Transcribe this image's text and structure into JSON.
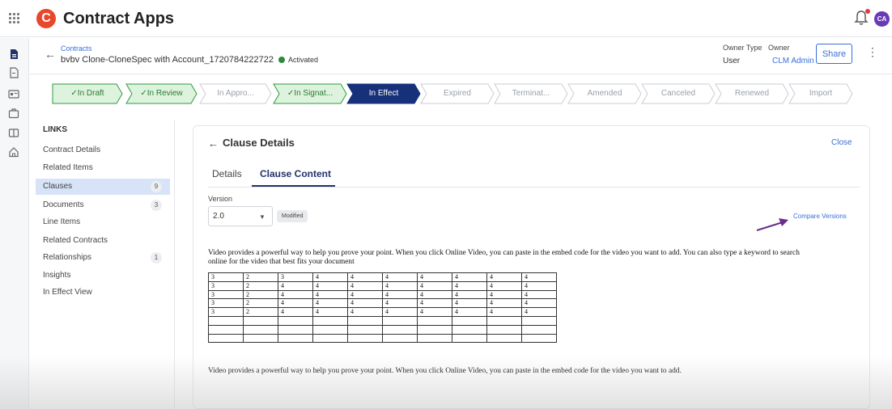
{
  "app": {
    "logo_letter": "C",
    "title": "Contract Apps",
    "avatar_initials": "CA",
    "brand_color": "#e8472b",
    "accent": "#3a6fd8"
  },
  "header": {
    "breadcrumb": "Contracts",
    "contract_name": "bvbv Clone-CloneSpec  with  Account_1720784222722",
    "status": "Activated",
    "owner_type_label": "Owner Type",
    "owner_type_value": "User",
    "owner_label": "Owner",
    "owner_value": "CLM Admin",
    "share_label": "Share",
    "menu_icon": "⋮"
  },
  "stages": [
    {
      "label": "✓In Draft",
      "state": "done"
    },
    {
      "label": "✓In Review",
      "state": "done"
    },
    {
      "label": "In Appro...",
      "state": "future"
    },
    {
      "label": "✓In Signat...",
      "state": "done"
    },
    {
      "label": "In Effect",
      "state": "current"
    },
    {
      "label": "Expired",
      "state": "future"
    },
    {
      "label": "Terminat...",
      "state": "future"
    },
    {
      "label": "Amended",
      "state": "future"
    },
    {
      "label": "Canceled",
      "state": "future"
    },
    {
      "label": "Renewed",
      "state": "future"
    },
    {
      "label": "Import",
      "state": "future"
    }
  ],
  "links": {
    "title": "LINKS",
    "items": [
      {
        "label": "Contract Details"
      },
      {
        "label": "Related Items"
      },
      {
        "label": "Clauses",
        "count": "9",
        "active": true
      },
      {
        "label": "Documents",
        "count": "3"
      },
      {
        "label": "Line Items"
      },
      {
        "label": "Related Contracts"
      },
      {
        "label": "Relationships",
        "count": "1"
      },
      {
        "label": "Insights"
      },
      {
        "label": "In Effect View"
      }
    ]
  },
  "clause": {
    "back_icon": "←",
    "title": "Clause Details",
    "close_label": "Close",
    "tabs": [
      {
        "label": "Details"
      },
      {
        "label": "Clause Content"
      }
    ],
    "version_label": "Version",
    "version_value": "2.0",
    "modified_badge": "Modified",
    "compare_label": "Compare Versions",
    "paragraph1_line1": "Video provides a powerful way to help you prove your point. When you click Online Video, you can paste in the embed code for the video you want to add. You can also type a keyword to search",
    "paragraph1_line2": "online for the video that best fits your document",
    "paragraph2": "Video provides a powerful way to help you prove your point. When you click Online Video, you can paste in the embed code for the video you want to add.",
    "table": [
      [
        "3",
        "2",
        "3",
        "4",
        "4",
        "4",
        "4",
        "4",
        "4",
        "4"
      ],
      [
        "3",
        "2",
        "4",
        "4",
        "4",
        "4",
        "4",
        "4",
        "4",
        "4"
      ],
      [
        "3",
        "2",
        "4",
        "4",
        "4",
        "4",
        "4",
        "4",
        "4",
        "4"
      ],
      [
        "3",
        "2",
        "4",
        "4",
        "4",
        "4",
        "4",
        "4",
        "4",
        "4"
      ],
      [
        "3",
        "2",
        "4",
        "4",
        "4",
        "4",
        "4",
        "4",
        "4",
        "4"
      ],
      [
        "",
        "",
        "",
        "",
        "",
        "",
        "",
        "",
        "",
        ""
      ],
      [
        "",
        "",
        "",
        "",
        "",
        "",
        "",
        "",
        "",
        ""
      ],
      [
        "",
        "",
        "",
        "",
        "",
        "",
        "",
        "",
        "",
        ""
      ]
    ]
  }
}
